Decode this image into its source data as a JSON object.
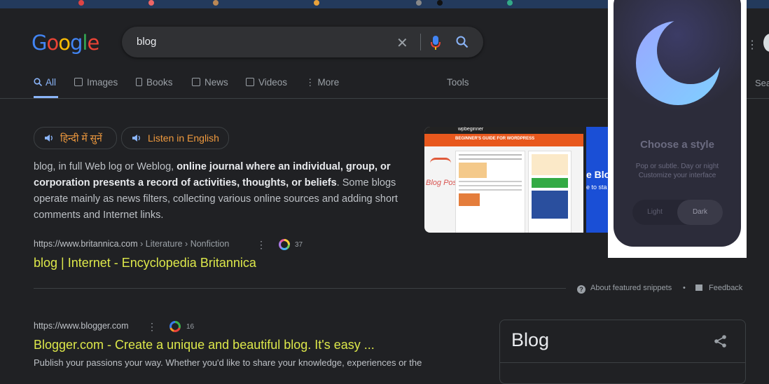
{
  "search": {
    "query": "blog",
    "logo": "Google"
  },
  "tabs": [
    {
      "label": "All",
      "icon": "search-icon"
    },
    {
      "label": "Images",
      "icon": "image-icon"
    },
    {
      "label": "Books",
      "icon": "book-icon"
    },
    {
      "label": "News",
      "icon": "news-icon"
    },
    {
      "label": "Videos",
      "icon": "video-icon"
    },
    {
      "label": "More",
      "icon": "more-vert-icon"
    },
    {
      "label": "Tools"
    }
  ],
  "header_right": {
    "search_label": "Search"
  },
  "listen": {
    "hindi": "हिन्दी में सुनें",
    "english": "Listen in English"
  },
  "snippet": {
    "lead": "blog, in full Web log or Weblog, ",
    "bold": "online journal where an individual, group, or corporation presents a record of activities, thoughts, or beliefs",
    "tail": ". Some blogs operate mainly as news filters, collecting various online sources and adding short comments and Internet links."
  },
  "result1": {
    "domain": "https://www.britannica.com",
    "path": " › Literature › Nonfiction",
    "count": "37",
    "title": "blog | Internet - Encyclopedia Britannica"
  },
  "footer": {
    "about": "About featured snippets",
    "sep": "•",
    "feedback": "Feedback"
  },
  "result2": {
    "domain": "https://www.blogger.com",
    "count": "16",
    "title": "Blogger.com - Create a unique and beautiful blog. It's easy ...",
    "desc": "Publish your passions your way. Whether you'd like to share your knowledge, experiences or the"
  },
  "knowledge_panel": {
    "title": "Blog"
  },
  "thumbnail": {
    "site_name": "wpbeginner",
    "banner": "BEGINNER'S GUIDE FOR WORDPRESS",
    "caption": "Blog Posts",
    "right_text": "e Blo",
    "right_sub": "e to sta"
  },
  "popup": {
    "heading": "Choose a style",
    "sub1": "Pop or subtle. Day or night",
    "sub2": "Customize your interface",
    "light": "Light",
    "dark": "Dark"
  },
  "colors": {
    "background": "#202124",
    "link": "#dde84a",
    "accent": "#8ab4f8",
    "listen": "#f09a3e"
  }
}
